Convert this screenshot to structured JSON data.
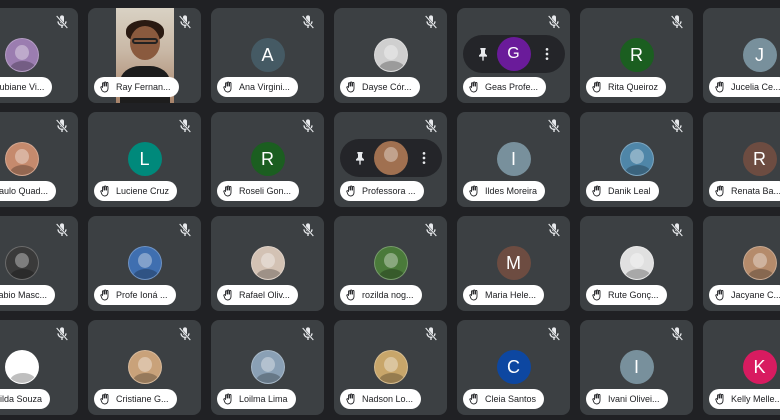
{
  "meeting": {
    "participants": [
      {
        "name": "Rubiane Vi...",
        "avatar": {
          "kind": "photo",
          "color": "#9b7db0"
        }
      },
      {
        "name": "Ray Fernan...",
        "avatar": {
          "kind": "video"
        }
      },
      {
        "name": "Ana Virgini...",
        "avatar": {
          "kind": "initial",
          "letter": "A",
          "color": "#455a64"
        }
      },
      {
        "name": "Dayse Cór...",
        "avatar": {
          "kind": "photo",
          "color": "#cfcfcf"
        }
      },
      {
        "name": "Geas Profe...",
        "avatar": {
          "kind": "pinned",
          "letter": "G",
          "color": "#6a1b9a"
        }
      },
      {
        "name": "Rita Queiroz",
        "avatar": {
          "kind": "initial",
          "letter": "R",
          "color": "#1b5e20"
        }
      },
      {
        "name": "Jucelia Ce...",
        "avatar": {
          "kind": "initial",
          "letter": "J",
          "color": "#78909c"
        }
      },
      {
        "name": "Paulo Quad...",
        "avatar": {
          "kind": "photo",
          "color": "#c58a6d"
        }
      },
      {
        "name": "Luciene Cruz",
        "avatar": {
          "kind": "initial",
          "letter": "L",
          "color": "#00897b"
        }
      },
      {
        "name": "Roseli Gon...",
        "avatar": {
          "kind": "initial",
          "letter": "R",
          "color": "#1b5e20"
        }
      },
      {
        "name": "Professora ...",
        "avatar": {
          "kind": "pinned-photo",
          "color": "#a07050"
        }
      },
      {
        "name": "Ildes Moreira",
        "avatar": {
          "kind": "initial",
          "letter": "I",
          "color": "#78909c"
        }
      },
      {
        "name": "Danik Leal",
        "avatar": {
          "kind": "photo",
          "color": "#4f86a8"
        }
      },
      {
        "name": "Renata Ba...",
        "avatar": {
          "kind": "initial",
          "letter": "R",
          "color": "#6d4c41"
        }
      },
      {
        "name": "Fabio Masc...",
        "avatar": {
          "kind": "photo",
          "color": "#3a3a3a"
        }
      },
      {
        "name": "Profe Ioná ...",
        "avatar": {
          "kind": "photo",
          "color": "#3f6fb0"
        }
      },
      {
        "name": "Rafael Oliv...",
        "avatar": {
          "kind": "photo",
          "color": "#d3c2b4"
        }
      },
      {
        "name": "rozilda nog...",
        "avatar": {
          "kind": "photo",
          "color": "#4a7a3a"
        }
      },
      {
        "name": "Maria Hele...",
        "avatar": {
          "kind": "initial",
          "letter": "M",
          "color": "#6d4c41"
        }
      },
      {
        "name": "Rute Gonç...",
        "avatar": {
          "kind": "photo",
          "color": "#e0e0e0"
        }
      },
      {
        "name": "Jacyane C...",
        "avatar": {
          "kind": "photo",
          "color": "#b58b6b"
        }
      },
      {
        "name": "Gilda Souza",
        "avatar": {
          "kind": "photo",
          "color": "#ffffff"
        }
      },
      {
        "name": "Cristiane G...",
        "avatar": {
          "kind": "photo",
          "color": "#c9a27a"
        }
      },
      {
        "name": "Loilma Lima",
        "avatar": {
          "kind": "photo",
          "color": "#8aa0b5"
        }
      },
      {
        "name": "Nadson Lo...",
        "avatar": {
          "kind": "photo",
          "color": "#c8a66a"
        }
      },
      {
        "name": "Cleia Santos",
        "avatar": {
          "kind": "initial",
          "letter": "C",
          "color": "#0d47a1"
        }
      },
      {
        "name": "Ivani Olivei...",
        "avatar": {
          "kind": "initial",
          "letter": "I",
          "color": "#78909c"
        }
      },
      {
        "name": "Kelly Melle...",
        "avatar": {
          "kind": "initial",
          "letter": "K",
          "color": "#d81b60"
        }
      }
    ]
  }
}
